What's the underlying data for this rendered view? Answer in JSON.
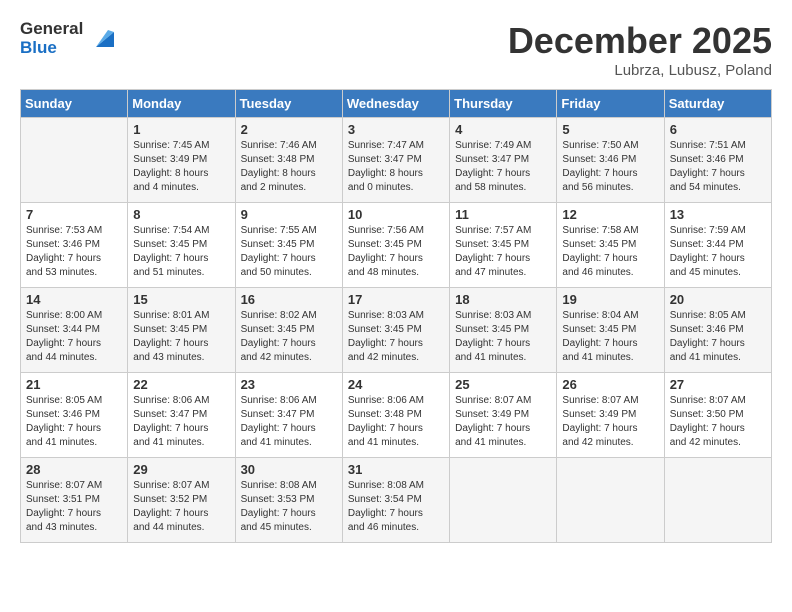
{
  "header": {
    "logo_general": "General",
    "logo_blue": "Blue",
    "month_title": "December 2025",
    "location": "Lubrza, Lubusz, Poland"
  },
  "days_of_week": [
    "Sunday",
    "Monday",
    "Tuesday",
    "Wednesday",
    "Thursday",
    "Friday",
    "Saturday"
  ],
  "weeks": [
    [
      {
        "day": "",
        "content": ""
      },
      {
        "day": "1",
        "content": "Sunrise: 7:45 AM\nSunset: 3:49 PM\nDaylight: 8 hours\nand 4 minutes."
      },
      {
        "day": "2",
        "content": "Sunrise: 7:46 AM\nSunset: 3:48 PM\nDaylight: 8 hours\nand 2 minutes."
      },
      {
        "day": "3",
        "content": "Sunrise: 7:47 AM\nSunset: 3:47 PM\nDaylight: 8 hours\nand 0 minutes."
      },
      {
        "day": "4",
        "content": "Sunrise: 7:49 AM\nSunset: 3:47 PM\nDaylight: 7 hours\nand 58 minutes."
      },
      {
        "day": "5",
        "content": "Sunrise: 7:50 AM\nSunset: 3:46 PM\nDaylight: 7 hours\nand 56 minutes."
      },
      {
        "day": "6",
        "content": "Sunrise: 7:51 AM\nSunset: 3:46 PM\nDaylight: 7 hours\nand 54 minutes."
      }
    ],
    [
      {
        "day": "7",
        "content": "Sunrise: 7:53 AM\nSunset: 3:46 PM\nDaylight: 7 hours\nand 53 minutes."
      },
      {
        "day": "8",
        "content": "Sunrise: 7:54 AM\nSunset: 3:45 PM\nDaylight: 7 hours\nand 51 minutes."
      },
      {
        "day": "9",
        "content": "Sunrise: 7:55 AM\nSunset: 3:45 PM\nDaylight: 7 hours\nand 50 minutes."
      },
      {
        "day": "10",
        "content": "Sunrise: 7:56 AM\nSunset: 3:45 PM\nDaylight: 7 hours\nand 48 minutes."
      },
      {
        "day": "11",
        "content": "Sunrise: 7:57 AM\nSunset: 3:45 PM\nDaylight: 7 hours\nand 47 minutes."
      },
      {
        "day": "12",
        "content": "Sunrise: 7:58 AM\nSunset: 3:45 PM\nDaylight: 7 hours\nand 46 minutes."
      },
      {
        "day": "13",
        "content": "Sunrise: 7:59 AM\nSunset: 3:44 PM\nDaylight: 7 hours\nand 45 minutes."
      }
    ],
    [
      {
        "day": "14",
        "content": "Sunrise: 8:00 AM\nSunset: 3:44 PM\nDaylight: 7 hours\nand 44 minutes."
      },
      {
        "day": "15",
        "content": "Sunrise: 8:01 AM\nSunset: 3:45 PM\nDaylight: 7 hours\nand 43 minutes."
      },
      {
        "day": "16",
        "content": "Sunrise: 8:02 AM\nSunset: 3:45 PM\nDaylight: 7 hours\nand 42 minutes."
      },
      {
        "day": "17",
        "content": "Sunrise: 8:03 AM\nSunset: 3:45 PM\nDaylight: 7 hours\nand 42 minutes."
      },
      {
        "day": "18",
        "content": "Sunrise: 8:03 AM\nSunset: 3:45 PM\nDaylight: 7 hours\nand 41 minutes."
      },
      {
        "day": "19",
        "content": "Sunrise: 8:04 AM\nSunset: 3:45 PM\nDaylight: 7 hours\nand 41 minutes."
      },
      {
        "day": "20",
        "content": "Sunrise: 8:05 AM\nSunset: 3:46 PM\nDaylight: 7 hours\nand 41 minutes."
      }
    ],
    [
      {
        "day": "21",
        "content": "Sunrise: 8:05 AM\nSunset: 3:46 PM\nDaylight: 7 hours\nand 41 minutes."
      },
      {
        "day": "22",
        "content": "Sunrise: 8:06 AM\nSunset: 3:47 PM\nDaylight: 7 hours\nand 41 minutes."
      },
      {
        "day": "23",
        "content": "Sunrise: 8:06 AM\nSunset: 3:47 PM\nDaylight: 7 hours\nand 41 minutes."
      },
      {
        "day": "24",
        "content": "Sunrise: 8:06 AM\nSunset: 3:48 PM\nDaylight: 7 hours\nand 41 minutes."
      },
      {
        "day": "25",
        "content": "Sunrise: 8:07 AM\nSunset: 3:49 PM\nDaylight: 7 hours\nand 41 minutes."
      },
      {
        "day": "26",
        "content": "Sunrise: 8:07 AM\nSunset: 3:49 PM\nDaylight: 7 hours\nand 42 minutes."
      },
      {
        "day": "27",
        "content": "Sunrise: 8:07 AM\nSunset: 3:50 PM\nDaylight: 7 hours\nand 42 minutes."
      }
    ],
    [
      {
        "day": "28",
        "content": "Sunrise: 8:07 AM\nSunset: 3:51 PM\nDaylight: 7 hours\nand 43 minutes."
      },
      {
        "day": "29",
        "content": "Sunrise: 8:07 AM\nSunset: 3:52 PM\nDaylight: 7 hours\nand 44 minutes."
      },
      {
        "day": "30",
        "content": "Sunrise: 8:08 AM\nSunset: 3:53 PM\nDaylight: 7 hours\nand 45 minutes."
      },
      {
        "day": "31",
        "content": "Sunrise: 8:08 AM\nSunset: 3:54 PM\nDaylight: 7 hours\nand 46 minutes."
      },
      {
        "day": "",
        "content": ""
      },
      {
        "day": "",
        "content": ""
      },
      {
        "day": "",
        "content": ""
      }
    ]
  ]
}
